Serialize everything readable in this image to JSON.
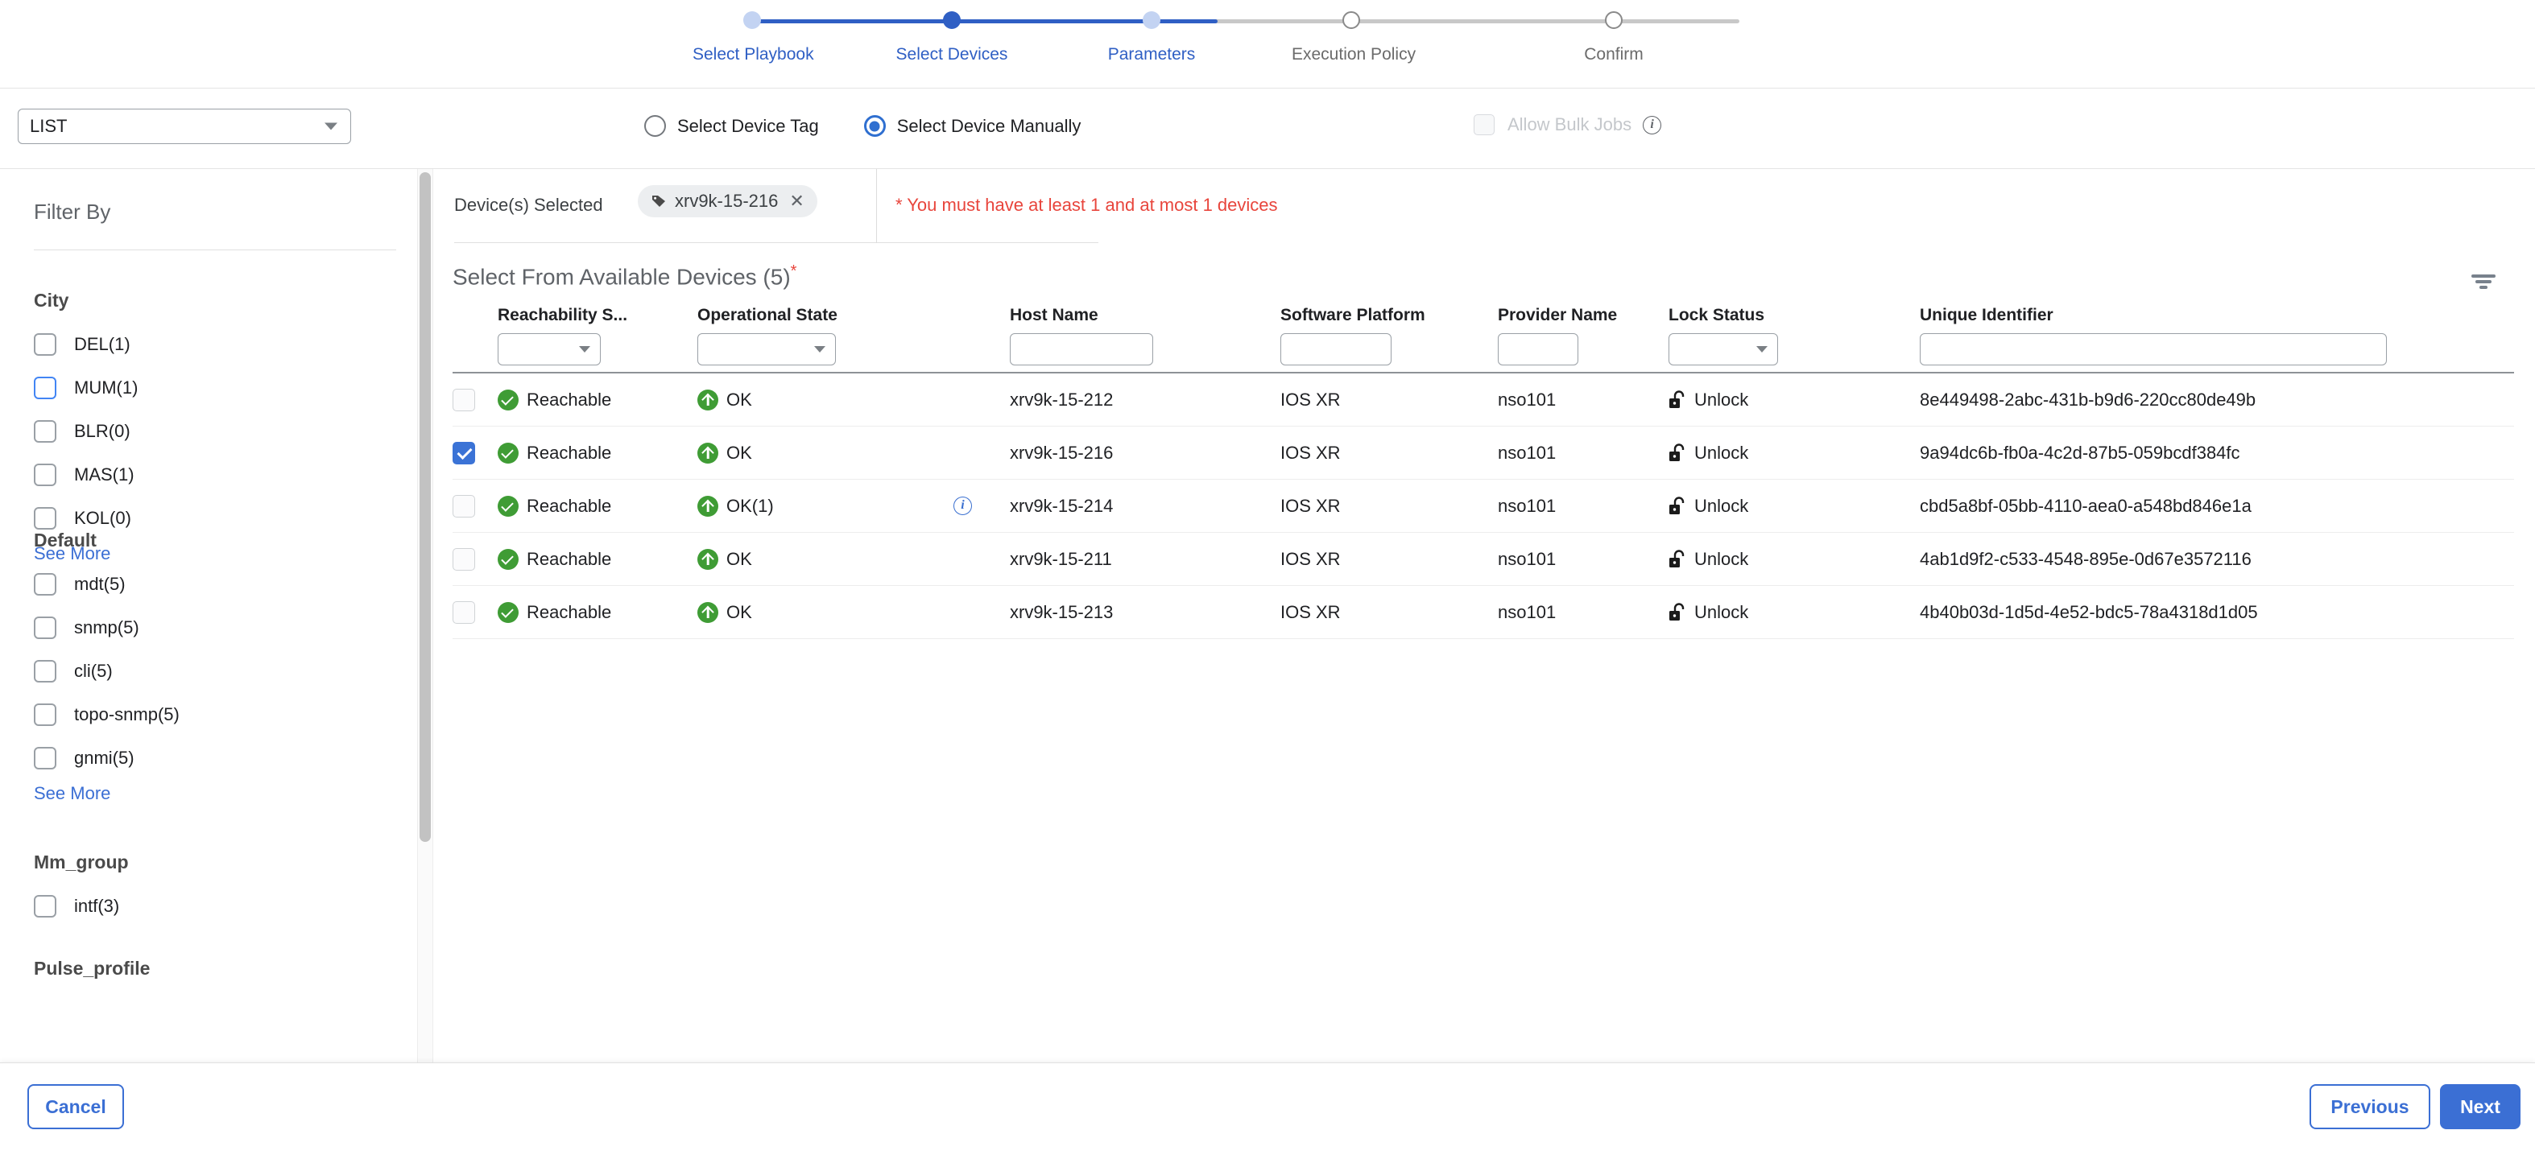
{
  "stepper": {
    "steps": [
      {
        "label": "Select Playbook",
        "state": "done"
      },
      {
        "label": "Select Devices",
        "state": "active"
      },
      {
        "label": "Parameters",
        "state": "done"
      },
      {
        "label": "Execution Policy",
        "state": "pending"
      },
      {
        "label": "Confirm",
        "state": "pending"
      }
    ],
    "accent_color": "#2f5fc4"
  },
  "toolbar": {
    "list_select_value": "LIST",
    "radios": [
      {
        "label": "Select Device Tag",
        "checked": false
      },
      {
        "label": "Select Device Manually",
        "checked": true
      }
    ],
    "bulk_jobs": {
      "label": "Allow Bulk Jobs",
      "checked": false,
      "disabled": true,
      "info_icon": "info-icon"
    }
  },
  "sidebar": {
    "title": "Filter By",
    "see_more_label": "See More",
    "groups": [
      {
        "title": "City",
        "items": [
          {
            "label": "DEL(1)",
            "checked": false,
            "focused": false
          },
          {
            "label": "MUM(1)",
            "checked": false,
            "focused": true
          },
          {
            "label": "BLR(0)",
            "checked": false,
            "focused": false
          },
          {
            "label": "MAS(1)",
            "checked": false,
            "focused": false
          },
          {
            "label": "KOL(0)",
            "checked": false,
            "focused": false
          }
        ],
        "see_more": true
      },
      {
        "title": "Default",
        "items": [
          {
            "label": "mdt(5)",
            "checked": false,
            "focused": false
          },
          {
            "label": "snmp(5)",
            "checked": false,
            "focused": false
          },
          {
            "label": "cli(5)",
            "checked": false,
            "focused": false
          },
          {
            "label": "topo-snmp(5)",
            "checked": false,
            "focused": false
          },
          {
            "label": "gnmi(5)",
            "checked": false,
            "focused": false
          }
        ],
        "see_more": true
      },
      {
        "title": "Mm_group",
        "items": [
          {
            "label": "intf(3)",
            "checked": false,
            "focused": false
          }
        ],
        "see_more": false
      },
      {
        "title": "Pulse_profile",
        "items": [],
        "see_more": false
      }
    ]
  },
  "selection": {
    "label": "Device(s) Selected",
    "chips": [
      {
        "text": "xrv9k-15-216",
        "icon": "tag-icon",
        "remove_icon": "close-icon"
      }
    ],
    "error_message": "* You must have at least 1 and at most 1 devices",
    "error_color": "#e8453c"
  },
  "table": {
    "title": "Select From Available Devices (5)",
    "required_marker": "*",
    "filter_icon": "filter-icon",
    "columns": [
      {
        "key": "checkbox",
        "label": "",
        "control": "none"
      },
      {
        "key": "reach",
        "label": "Reachability S...",
        "control": "select"
      },
      {
        "key": "oper",
        "label": "Operational State",
        "control": "select"
      },
      {
        "key": "host",
        "label": "Host Name",
        "control": "text"
      },
      {
        "key": "platform",
        "label": "Software Platform",
        "control": "text"
      },
      {
        "key": "provider",
        "label": "Provider Name",
        "control": "text"
      },
      {
        "key": "lock",
        "label": "Lock Status",
        "control": "select"
      },
      {
        "key": "uid",
        "label": "Unique Identifier",
        "control": "text"
      }
    ],
    "filter_values": {
      "reach": "",
      "oper": "",
      "host": "",
      "platform": "",
      "provider": "",
      "lock": "",
      "uid": ""
    },
    "rows": [
      {
        "selected": false,
        "reach": "Reachable",
        "oper": "OK",
        "oper_info": false,
        "host": "xrv9k-15-212",
        "platform": "IOS XR",
        "provider": "nso101",
        "lock": "Unlock",
        "uid": "8e449498-2abc-431b-b9d6-220cc80de49b"
      },
      {
        "selected": true,
        "reach": "Reachable",
        "oper": "OK",
        "oper_info": false,
        "host": "xrv9k-15-216",
        "platform": "IOS XR",
        "provider": "nso101",
        "lock": "Unlock",
        "uid": "9a94dc6b-fb0a-4c2d-87b5-059bcdf384fc"
      },
      {
        "selected": false,
        "reach": "Reachable",
        "oper": "OK(1)",
        "oper_info": true,
        "host": "xrv9k-15-214",
        "platform": "IOS XR",
        "provider": "nso101",
        "lock": "Unlock",
        "uid": "cbd5a8bf-05bb-4110-aea0-a548bd846e1a"
      },
      {
        "selected": false,
        "reach": "Reachable",
        "oper": "OK",
        "oper_info": false,
        "host": "xrv9k-15-211",
        "platform": "IOS XR",
        "provider": "nso101",
        "lock": "Unlock",
        "uid": "4ab1d9f2-c533-4548-895e-0d67e3572116"
      },
      {
        "selected": false,
        "reach": "Reachable",
        "oper": "OK",
        "oper_info": false,
        "host": "xrv9k-15-213",
        "platform": "IOS XR",
        "provider": "nso101",
        "lock": "Unlock",
        "uid": "4b40b03d-1d5d-4e52-bdc5-78a4318d1d05"
      }
    ],
    "status_colors": {
      "reachable": "#3f9c35",
      "ok": "#3f9c35"
    }
  },
  "footer": {
    "cancel_label": "Cancel",
    "previous_label": "Previous",
    "next_label": "Next",
    "primary_color": "#3b6fd4"
  }
}
